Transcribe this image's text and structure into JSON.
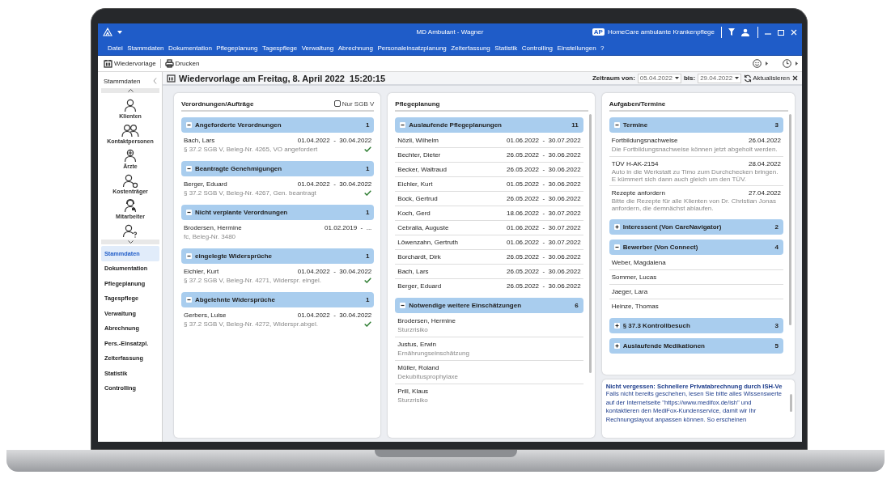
{
  "window": {
    "title": "MD Ambulant - Wagner",
    "workspace_badge": "AP",
    "workspace": "HomeCare ambulante Krankenpflege"
  },
  "menu": [
    "Datei",
    "Stammdaten",
    "Dokumentation",
    "Pflegeplanung",
    "Tagespflege",
    "Verwaltung",
    "Abrechnung",
    "Personaleinsatzplanung",
    "Zeiterfassung",
    "Statistik",
    "Controlling",
    "Einstellungen",
    "?"
  ],
  "toolbar": {
    "buttons": [
      {
        "label": "Wiedervorlage",
        "kind": "calendar"
      },
      {
        "label": "Drucken",
        "kind": "printer"
      }
    ]
  },
  "sidebar": {
    "header": "Stammdaten",
    "modules": [
      {
        "label": "Klienten",
        "kind": "person"
      },
      {
        "label": "Kontaktpersonen",
        "kind": "people"
      },
      {
        "label": "Ärzte",
        "kind": "doctor"
      },
      {
        "label": "Kostenträger",
        "kind": "payer"
      },
      {
        "label": "Mitarbeiter",
        "kind": "staff"
      },
      {
        "kind": "unknown"
      }
    ],
    "nav": [
      {
        "label": "Stammdaten",
        "selected": true
      },
      {
        "label": "Dokumentation",
        "selected": false
      },
      {
        "label": "Pflegeplanung",
        "selected": false
      },
      {
        "label": "Tagespflege",
        "selected": false
      },
      {
        "label": "Verwaltung",
        "selected": false
      },
      {
        "label": "Abrechnung",
        "selected": false
      },
      {
        "label": "Pers.-Einsatzpl.",
        "selected": false
      },
      {
        "label": "Zeiterfassung",
        "selected": false
      },
      {
        "label": "Statistik",
        "selected": false
      },
      {
        "label": "Controlling",
        "selected": false
      }
    ]
  },
  "header": {
    "title": "Wiedervorlage am Freitag, 8. April 2022  15:20:15",
    "range_label": "Zeitraum von:",
    "from": "05.04.2022",
    "to_label": "bis:",
    "to": "29.04.2022",
    "refresh": "Aktualisieren"
  },
  "panels": [
    {
      "title": "Verordnungen/Aufträge",
      "filter": {
        "label": "Nur SGB V",
        "checked": false
      },
      "groups": [
        {
          "title": "Angeforderte Verordnungen",
          "count": "1",
          "expanded": true,
          "items": [
            {
              "name": "Bach, Lars",
              "period": "01.04.2022  -  30.04.2022",
              "detail": "§ 37.2 SGB V, Beleg-Nr. 4265, VO angefordert",
              "done": true
            }
          ]
        },
        {
          "title": "Beantragte Genehmigungen",
          "count": "1",
          "expanded": true,
          "items": [
            {
              "name": "Berger, Eduard",
              "period": "01.04.2022  -  30.04.2022",
              "detail": "§ 37.2 SGB V, Beleg-Nr. 4267, Gen. beantragt",
              "done": true
            }
          ]
        },
        {
          "title": "Nicht verplante Verordnungen",
          "count": "1",
          "expanded": true,
          "items": [
            {
              "name": "Brodersen, Hermine",
              "period": "01.02.2019  -  ...",
              "detail": "fc, Beleg-Nr. 3480",
              "done": false
            }
          ]
        },
        {
          "title": "eingelegte Widersprüche",
          "count": "1",
          "expanded": true,
          "items": [
            {
              "name": "Eichler, Kurt",
              "period": "01.04.2022  -  30.04.2022",
              "detail": "§ 37.2 SGB V, Beleg-Nr. 4271, Widerspr. eingel.",
              "done": true
            }
          ]
        },
        {
          "title": "Abgelehnte Widersprüche",
          "count": "1",
          "expanded": true,
          "items": [
            {
              "name": "Gerbers, Luise",
              "period": "01.04.2022  -  30.04.2022",
              "detail": "§ 37.2 SGB V, Beleg-Nr. 4272, Widerspr.abgel.",
              "done": true
            }
          ]
        }
      ]
    },
    {
      "title": "Pflegeplanung",
      "groups": [
        {
          "title": "Auslaufende Pflegeplanungen",
          "count": "11",
          "expanded": true,
          "items": [
            {
              "name": "Nözli, Wilhelm",
              "period": "01.06.2022  -  30.07.2022"
            },
            {
              "name": "Bechter, Dieter",
              "period": "26.05.2022  -  30.06.2022"
            },
            {
              "name": "Becker, Waltraud",
              "period": "26.05.2022  -  30.06.2022"
            },
            {
              "name": "Eichler, Kurt",
              "period": "01.05.2022  -  30.06.2022"
            },
            {
              "name": "Bock, Gertrud",
              "period": "26.05.2022  -  30.06.2022"
            },
            {
              "name": "Koch, Gerd",
              "period": "18.06.2022  -  30.07.2022"
            },
            {
              "name": "Cebralla, Auguste",
              "period": "01.06.2022  -  30.07.2022"
            },
            {
              "name": "Löwenzahn, Gertruth",
              "period": "01.06.2022  -  30.07.2022"
            },
            {
              "name": "Borchardt, Dirk",
              "period": "26.05.2022  -  30.06.2022"
            },
            {
              "name": "Bach, Lars",
              "period": "26.05.2022  -  30.06.2022"
            },
            {
              "name": "Berger, Eduard",
              "period": "26.05.2022  -  30.06.2022"
            }
          ]
        },
        {
          "title": "Notwendige weitere Einschätzungen",
          "count": "6",
          "expanded": true,
          "items": [
            {
              "name": "Brodersen, Hermine",
              "detail": "Sturzrisiko"
            },
            {
              "name": "Justus, Erwin",
              "detail": "Ernährungseinschätzung"
            },
            {
              "name": "Müller, Roland",
              "detail": "Dekubitusprophylaxe"
            },
            {
              "name": "Prill, Klaus",
              "detail": "Sturzrisiko"
            }
          ]
        }
      ]
    },
    {
      "title": "Aufgaben/Termine",
      "groups": [
        {
          "title": "Termine",
          "count": "3",
          "expanded": true,
          "items": [
            {
              "name": "Fortbildungsnachweise",
              "period": "26.04.2022",
              "detail": "Die Fortbildungsnachweise können jetzt abgeholt werden."
            },
            {
              "name": "TÜV H-AK-2154",
              "period": "28.04.2022",
              "detail": "Auto in die Werkstatt zu Timo zum Durchchecken bringen. E kümmert sich dann auch gleich um den TÜV."
            },
            {
              "name": "Rezepte anfordern",
              "period": "27.04.2022",
              "detail": "Bitte die Rezepte für alle Klienten von Dr. Christian Jonas anfordern, die demnächst  ablaufen."
            }
          ]
        },
        {
          "title": "Interessent (Von CareNavigator)",
          "count": "2",
          "expanded": false
        },
        {
          "title": "Bewerber (Von Connect)",
          "count": "4",
          "expanded": true,
          "items": [
            {
              "name": "Weber, Magdalena"
            },
            {
              "name": "Sommer, Lucas"
            },
            {
              "name": "Jaeger, Lara"
            },
            {
              "name": "Heinze, Thomas"
            }
          ]
        },
        {
          "title": "§ 37.3 Kontrollbesuch",
          "count": "3",
          "expanded": false
        },
        {
          "title": "Auslaufende Medikationen",
          "count": "5",
          "expanded": false
        }
      ]
    }
  ],
  "note": {
    "title": "Nicht vergessen: Schnellere Privatabrechnung durch ISH-Ve",
    "text": "Falls nicht bereits geschehen, lesen Sie bitte alles Wissenswerte auf der Internetseite \"https://www.medifox.de/ish\" und kontaktieren den MediFox-Kundenservice, damit wir Ihr Rechnungslayout anpassen können. So erscheinen"
  }
}
